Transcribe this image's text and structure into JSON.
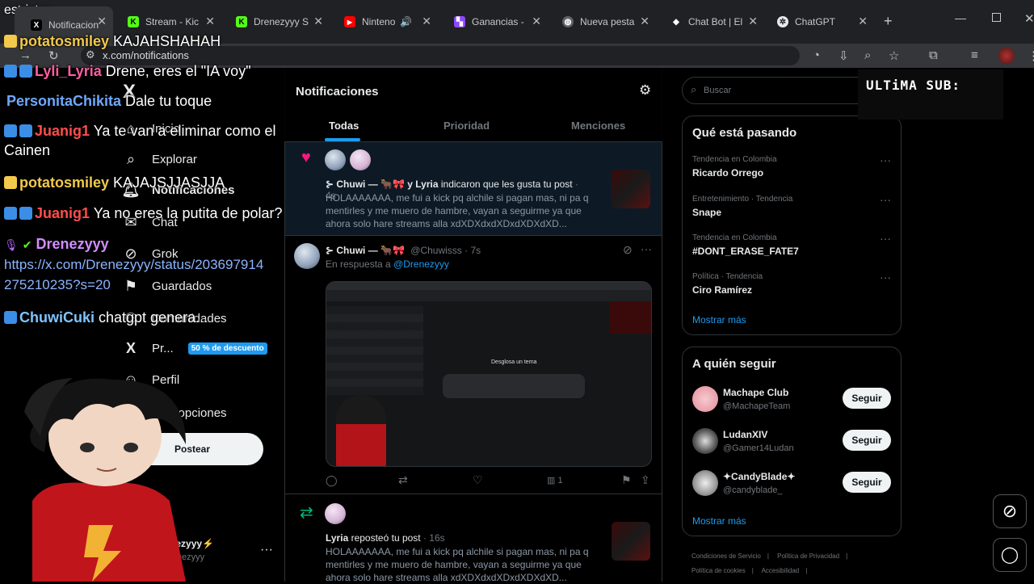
{
  "overlay_top_text": "estrictos",
  "tabs": [
    {
      "label": "Notificacion",
      "fav": "X",
      "fav_bg": "#000",
      "fav_color": "#fff"
    },
    {
      "label": "Stream - Kic",
      "fav": "K",
      "fav_bg": "#53fc18",
      "fav_color": "#000"
    },
    {
      "label": "Drenezyyy S",
      "fav": "K",
      "fav_bg": "#53fc18",
      "fav_color": "#000"
    },
    {
      "label": "Ninteno",
      "fav": "▶",
      "fav_bg": "#ff0000",
      "fav_color": "#fff"
    },
    {
      "label": "Ganancias -",
      "fav": "▚",
      "fav_bg": "#9146ff",
      "fav_color": "#fff"
    },
    {
      "label": "Nueva pesta",
      "fav": "◍",
      "fav_bg": "#5f6368",
      "fav_color": "#fff"
    },
    {
      "label": "Chat Bot | El",
      "fav": "◆",
      "fav_bg": "#202124",
      "fav_color": "#fff"
    },
    {
      "label": "ChatGPT",
      "fav": "✲",
      "fav_bg": "#e8eaed",
      "fav_color": "#202124"
    }
  ],
  "address": "x.com/notifications",
  "nav": {
    "inicio": "Inicio",
    "explorar": "Explorar",
    "notificaciones": "Notificaciones",
    "chat": "Chat",
    "grok": "Grok",
    "guardados": "Guardados",
    "comunidades": "Comunidades",
    "premium": "Pr...",
    "premium_badge": "50 % de descuento",
    "perfil": "Perfil",
    "mas_opciones": "Más opciones",
    "post_button": "Postear",
    "account_name": "Drenezyyy⚡",
    "account_handle": "@Drenezyyy"
  },
  "header": {
    "title": "Notificaciones",
    "tab_all": "Todas",
    "tab_priority": "Prioridad",
    "tab_mentions": "Menciones"
  },
  "notifications": [
    {
      "kind": "like",
      "title_names": "⊱ Chuwi — 🐂🎀 y Lyria",
      "title_rest": " indicaron que les gusta tu post",
      "time": " · 4s",
      "text": "HOLAAAAAAA, me fui a kick pq alchile si pagan mas, ni pa q mentirles y me muero de hambre, vayan a seguirme ya que ahora solo hare streams alla xdXDXdxdXDxdXDXdXD..."
    },
    {
      "kind": "reply",
      "name": "⊱ Chuwi — 🐂🎀",
      "handle": "@Chuwisss · 7s",
      "reply_prefix": "En respuesta a ",
      "reply_to": "@Drenezyyy",
      "image_caption": "Desglosa un tema",
      "views": "1"
    },
    {
      "kind": "repost",
      "title_name": "Lyria",
      "title_rest": " reposteó tu post",
      "time": " · 16s",
      "text": "HOLAAAAAAA, me fui a kick pq alchile si pagan mas, ni pa q mentirles y me muero de hambre, vayan a seguirme ya que ahora solo hare streams alla xdXDXdxdXDxdXDXdXD..."
    }
  ],
  "search": {
    "placeholder": "Buscar"
  },
  "trends": {
    "title": "Qué está pasando",
    "items": [
      {
        "meta": "Tendencia en Colombia",
        "name": "Ricardo Orrego"
      },
      {
        "meta": "Entretenimiento · Tendencia",
        "name": "Snape"
      },
      {
        "meta": "Tendencia en Colombia",
        "name": "#DONT_ERASE_FATE7"
      },
      {
        "meta": "Política · Tendencia",
        "name": "Ciro Ramírez"
      }
    ],
    "show_more": "Mostrar más"
  },
  "who_to_follow": {
    "title": "A quién seguir",
    "items": [
      {
        "name": "Machape Club",
        "handle": "@MachapeTeam",
        "button": "Seguir"
      },
      {
        "name": "LudanXIV",
        "handle": "@Gamer14Ludan",
        "button": "Seguir"
      },
      {
        "name": "✦CandyBlade✦",
        "handle": "@candyblade_",
        "button": "Seguir"
      }
    ],
    "show_more": "Mostrar más"
  },
  "footer": {
    "terms": "Condiciones de Servicio",
    "privacy": "Política de Privacidad",
    "cookies": "Política de cookies",
    "accessibility": "Accesibilidad"
  },
  "stream_overlay": {
    "last_sub": "ULTiMA SUB:"
  },
  "chat": [
    {
      "user": "potatosmiley",
      "user_color": "#f2c94c",
      "msg": " KAJAHSHAHAH"
    },
    {
      "user": "Lyli_Lyria",
      "user_color": "#ff5fa2",
      "msg": " Drene, eres el \"IA voy\""
    },
    {
      "user": "PersonitaChikita",
      "user_color": "#6fa8ff",
      "msg": " Dale tu toque"
    },
    {
      "user": "Juanig1",
      "user_color": "#ff4d4d",
      "msg": " Ya te van a eliminar como el",
      "msg2": "Cainen"
    },
    {
      "user": "potatosmiley",
      "user_color": "#f2c94c",
      "msg": " KAJAJSJJASJJA"
    },
    {
      "user": "Juanig1",
      "user_color": "#ff4d4d",
      "msg": " Ya no eres la putita de polar?"
    },
    {
      "user": "Drenezyyy",
      "user_color": "#d28cff",
      "msg": "",
      "link": "https://x.com/Drenezyyy/status/203697914",
      "link2": "275210235?s=20"
    },
    {
      "user": "ChuwiCuki",
      "user_color": "#7fc4ff",
      "msg": " chatgpt genera..."
    }
  ],
  "colors": {
    "accent": "#1d9bf0",
    "like": "#f91880",
    "repost": "#00ba7c"
  }
}
